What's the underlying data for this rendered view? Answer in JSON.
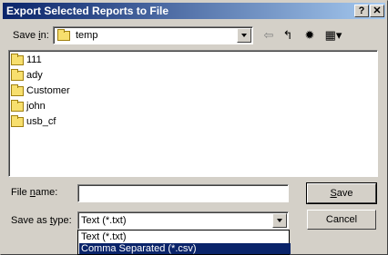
{
  "window": {
    "title": "Export Selected Reports to File",
    "help_glyph": "?",
    "close_glyph": "✕"
  },
  "save_in": {
    "label_prefix": "Save ",
    "label_underlined": "i",
    "label_suffix": "n:",
    "value": "temp"
  },
  "toolbar": {
    "back_glyph": "⇦",
    "up_glyph": "↰",
    "new_folder_glyph": "✹",
    "view_glyph": "▦▾"
  },
  "files": [
    {
      "name": "111"
    },
    {
      "name": "ady"
    },
    {
      "name": "Customer"
    },
    {
      "name": "john"
    },
    {
      "name": "usb_cf"
    }
  ],
  "file_name": {
    "label_prefix": "File ",
    "label_underlined": "n",
    "label_suffix": "ame:",
    "value": ""
  },
  "save_as_type": {
    "label_prefix": "Save as ",
    "label_underlined": "t",
    "label_suffix": "ype:",
    "value": "Text (*.txt)",
    "options": [
      "Text (*.txt)",
      "Comma Separated (*.csv)"
    ],
    "highlighted_index": 1
  },
  "buttons": {
    "save_underlined": "S",
    "save_rest": "ave",
    "cancel": "Cancel"
  }
}
